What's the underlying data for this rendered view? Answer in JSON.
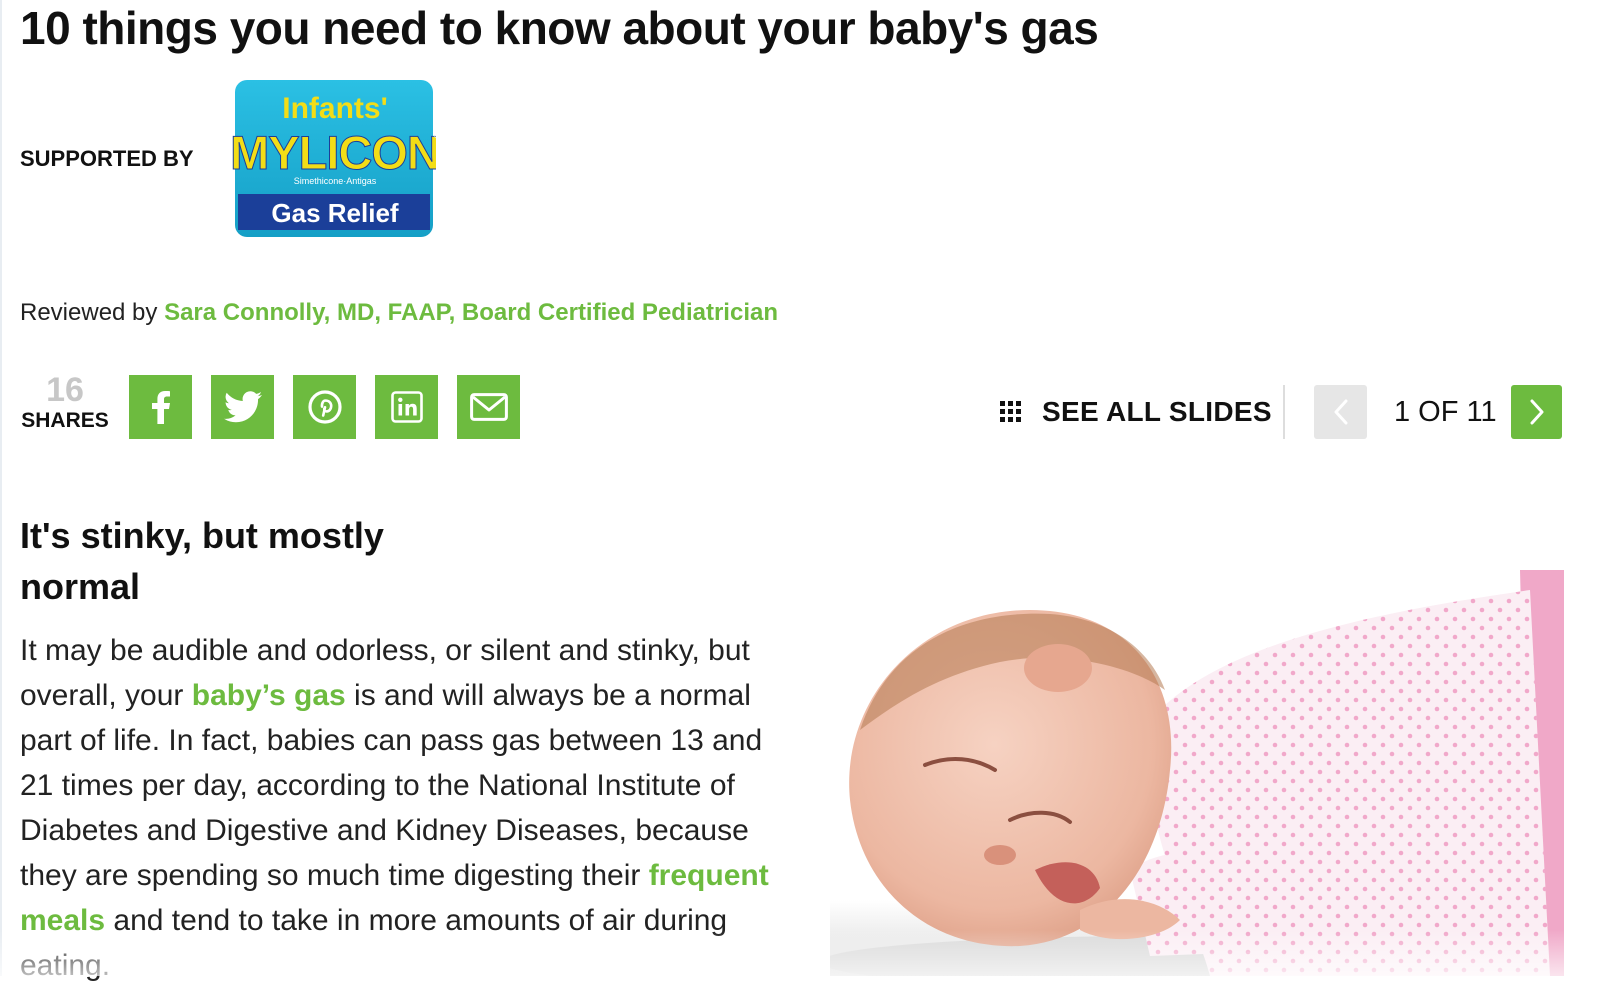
{
  "article": {
    "title": "10 things you need to know about your baby's gas",
    "supported_by": "SUPPORTED BY",
    "sponsor_logo": {
      "top": "Infants'",
      "brand": "MYLICON",
      "registered": "®",
      "tagline": "Simethicone·Antigas",
      "banner": "Gas Relief"
    },
    "reviewed_prefix": "Reviewed by",
    "reviewer": "Sara Connolly, MD, FAAP, Board Certified Pediatrician"
  },
  "share": {
    "count": "16",
    "label": "SHARES",
    "buttons": [
      {
        "name": "facebook",
        "icon": "facebook-icon"
      },
      {
        "name": "twitter",
        "icon": "twitter-icon"
      },
      {
        "name": "pinterest",
        "icon": "pinterest-icon"
      },
      {
        "name": "linkedin",
        "icon": "linkedin-icon"
      },
      {
        "name": "email",
        "icon": "email-icon"
      }
    ]
  },
  "slideshow": {
    "see_all_label": "SEE ALL SLIDES",
    "see_all_icon": "grid-icon",
    "counter": "1 OF 11",
    "prev_icon": "chevron-left-icon",
    "next_icon": "chevron-right-icon",
    "current_slide": {
      "title": "It's stinky, but mostly normal",
      "body": {
        "p1": "It may be audible and odorless, or silent and stinky, but overall, your ",
        "link1": "baby’s gas",
        "p2": " is and will always be a normal part of life. In fact, babies can pass gas between 13 and 21 times per day, according to the National Institute of Diabetes and Digestive and Kidney Diseases, because they are spending so much time digesting their ",
        "link2": "frequent meals",
        "p3": " and tend to take in more amounts of air during eating."
      },
      "image_alt": "crying baby lying on stomach in pink polka-dot pajamas"
    }
  },
  "colors": {
    "accent": "#6dbb3f",
    "logo_cyan": "#22b3d8",
    "logo_yellow": "#f3dd17",
    "logo_navy": "#1b3f99",
    "pajama_pink": "#f3b9d2"
  }
}
